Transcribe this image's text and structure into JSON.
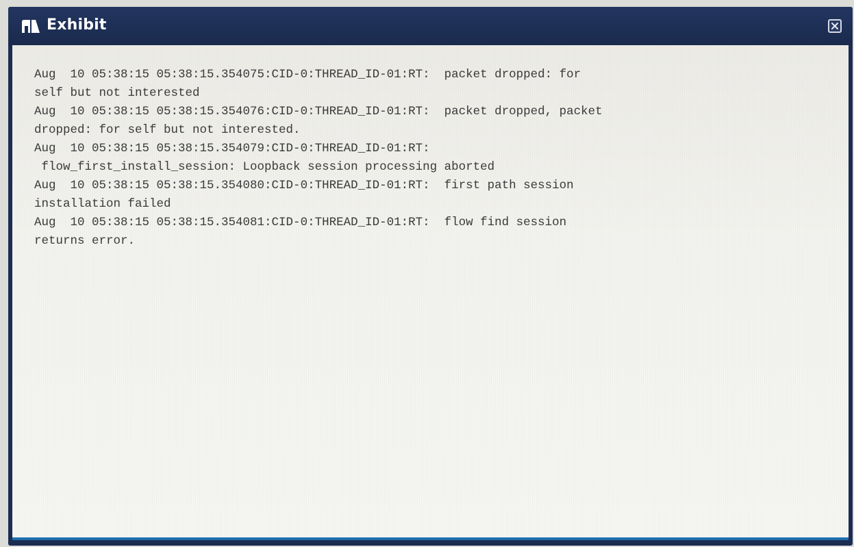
{
  "window": {
    "title": "Exhibit",
    "title_icon": "exhibit-icon",
    "close_icon": "close-icon"
  },
  "log": {
    "lines": [
      "Aug  10 05:38:15 05:38:15.354075:CID-0:THREAD_ID-01:RT:  packet dropped: for",
      "self but not interested",
      "Aug  10 05:38:15 05:38:15.354076:CID-0:THREAD_ID-01:RT:  packet dropped, packet",
      "dropped: for self but not interested.",
      "Aug  10 05:38:15 05:38:15.354079:CID-0:THREAD_ID-01:RT:",
      " flow_first_install_session: Loopback session processing aborted",
      "Aug  10 05:38:15 05:38:15.354080:CID-0:THREAD_ID-01:RT:  first path session",
      "installation failed",
      "Aug  10 05:38:15 05:38:15.354081:CID-0:THREAD_ID-01:RT:  flow find session",
      "returns error."
    ]
  },
  "colors": {
    "titlebar": "#1c2d52",
    "content_bg": "#f2f2ee",
    "text": "#3a3a3a",
    "bottom_border": "#1e6fae"
  }
}
